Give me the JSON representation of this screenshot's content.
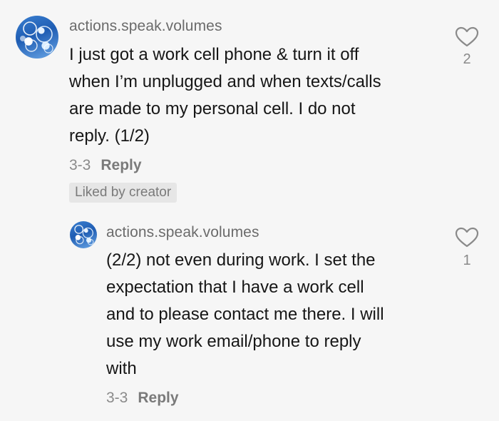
{
  "comments": [
    {
      "username": "actions.speak.volumes",
      "lines": [
        "I just got a work cell phone & turn it off",
        "when I’m unplugged and when texts/calls",
        "are made to my personal cell. I do not",
        "reply. (1/2)"
      ],
      "date": "3-3",
      "reply_label": "Reply",
      "badge": "Liked by creator",
      "like_count": "2",
      "icons": {
        "avatar": "bubbles-avatar",
        "like": "heart-outline-icon"
      }
    },
    {
      "username": "actions.speak.volumes",
      "lines": [
        "(2/2) not even during work. I set the",
        "expectation that I have a work cell",
        "and to please contact me there. I will",
        "use my work email/phone to reply",
        "with"
      ],
      "date": "3-3",
      "reply_label": "Reply",
      "like_count": "1",
      "icons": {
        "avatar": "bubbles-avatar",
        "like": "heart-outline-icon"
      }
    }
  ],
  "colors": {
    "background": "#f6f6f6",
    "text": "#161616",
    "muted": "#8a8a8a",
    "badge_bg": "#e6e6e6"
  }
}
